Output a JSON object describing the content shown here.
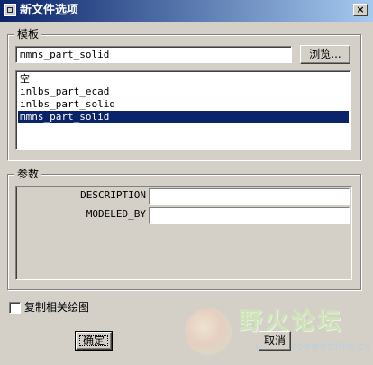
{
  "window": {
    "title": "新文件选项",
    "close_label": "×"
  },
  "template_group": {
    "legend": "模板",
    "input_value": "mmns_part_solid",
    "browse_label": "浏览...",
    "items": [
      {
        "label": "空",
        "selected": false
      },
      {
        "label": "inlbs_part_ecad",
        "selected": false
      },
      {
        "label": "inlbs_part_solid",
        "selected": false
      },
      {
        "label": "mmns_part_solid",
        "selected": true
      }
    ]
  },
  "params_group": {
    "legend": "参数",
    "params": [
      {
        "label": "DESCRIPTION",
        "value": ""
      },
      {
        "label": "MODELED_BY",
        "value": ""
      }
    ]
  },
  "copy_drawing": {
    "label": "复制相关绘图",
    "checked": false
  },
  "buttons": {
    "ok_label": "确定",
    "cancel_label": "取消"
  },
  "watermark": {
    "title": "野火论坛",
    "url": "www.proewildfire.cn"
  }
}
